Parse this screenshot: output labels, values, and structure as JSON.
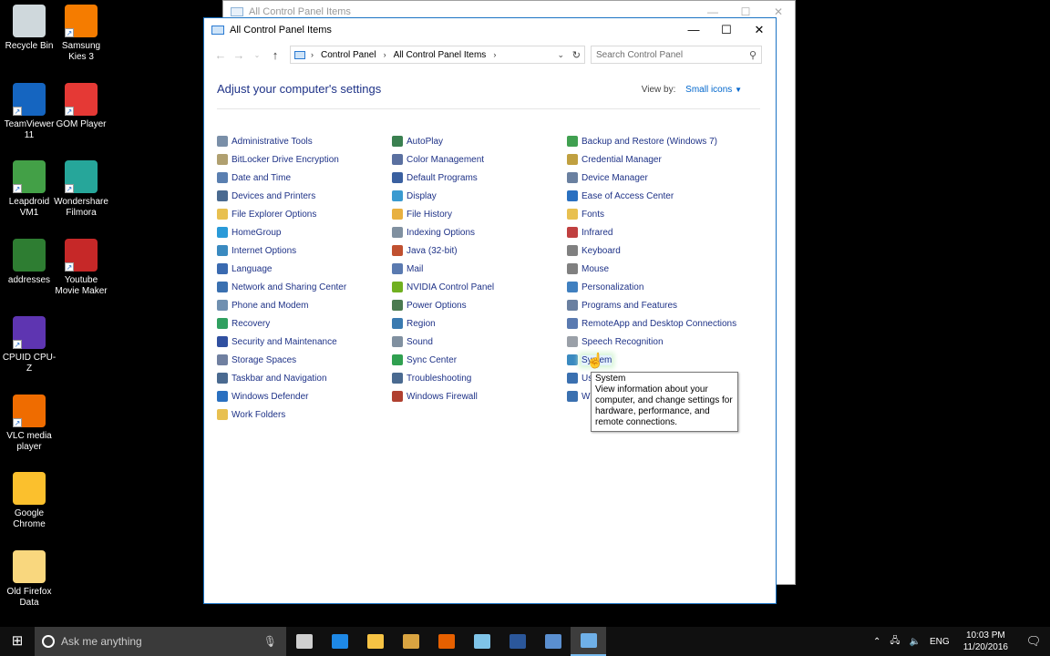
{
  "desktop": {
    "icons": [
      {
        "label": "Recycle Bin",
        "color": "#cfd8dc"
      },
      {
        "label": "Samsung Kies 3",
        "color": "#f57c00"
      },
      {
        "label": "TeamViewer 11",
        "color": "#1565c0"
      },
      {
        "label": "GOM Player",
        "color": "#e53935"
      },
      {
        "label": "Leapdroid VM1",
        "color": "#43a047"
      },
      {
        "label": "Wondershare Filmora",
        "color": "#26a69a"
      },
      {
        "label": "addresses",
        "color": "#2e7d32"
      },
      {
        "label": "Youtube Movie Maker",
        "color": "#c62828"
      },
      {
        "label": "CPUID CPU-Z",
        "color": "#5e35b1"
      },
      {
        "label": "VLC media player",
        "color": "#ef6c00"
      },
      {
        "label": "Google Chrome",
        "color": "#fbc02d"
      },
      {
        "label": "Old Firefox Data",
        "color": "#f9d77e"
      }
    ]
  },
  "bg_window": {
    "title": "All Control Panel Items"
  },
  "window": {
    "title": "All Control Panel Items",
    "breadcrumb": [
      "Control Panel",
      "All Control Panel Items"
    ],
    "search_placeholder": "Search Control Panel",
    "heading": "Adjust your computer's settings",
    "view_by_label": "View by:",
    "view_by_value": "Small icons"
  },
  "items": {
    "col1": [
      {
        "label": "Administrative Tools",
        "color": "#7a8fa8"
      },
      {
        "label": "BitLocker Drive Encryption",
        "color": "#b0a070"
      },
      {
        "label": "Date and Time",
        "color": "#5a7fb0"
      },
      {
        "label": "Devices and Printers",
        "color": "#4a6a90"
      },
      {
        "label": "File Explorer Options",
        "color": "#e8c050"
      },
      {
        "label": "HomeGroup",
        "color": "#2a9ad8"
      },
      {
        "label": "Internet Options",
        "color": "#3a8ac0"
      },
      {
        "label": "Language",
        "color": "#3a6ab0"
      },
      {
        "label": "Network and Sharing Center",
        "color": "#3a70b0"
      },
      {
        "label": "Phone and Modem",
        "color": "#7090b0"
      },
      {
        "label": "Recovery",
        "color": "#30a060"
      },
      {
        "label": "Security and Maintenance",
        "color": "#3050a0"
      },
      {
        "label": "Storage Spaces",
        "color": "#7080a0"
      },
      {
        "label": "Taskbar and Navigation",
        "color": "#4a6a90"
      },
      {
        "label": "Windows Defender",
        "color": "#2a70c0"
      },
      {
        "label": "Work Folders",
        "color": "#e8c050"
      }
    ],
    "col2": [
      {
        "label": "AutoPlay",
        "color": "#3a8050"
      },
      {
        "label": "Color Management",
        "color": "#5a70a0"
      },
      {
        "label": "Default Programs",
        "color": "#3a60a0"
      },
      {
        "label": "Display",
        "color": "#3a9ad0"
      },
      {
        "label": "File History",
        "color": "#e8b040"
      },
      {
        "label": "Indexing Options",
        "color": "#8090a0"
      },
      {
        "label": "Java (32-bit)",
        "color": "#c05030"
      },
      {
        "label": "Mail",
        "color": "#5a7ab0"
      },
      {
        "label": "NVIDIA Control Panel",
        "color": "#70b020"
      },
      {
        "label": "Power Options",
        "color": "#4a7a50"
      },
      {
        "label": "Region",
        "color": "#3a7ab0"
      },
      {
        "label": "Sound",
        "color": "#8090a0"
      },
      {
        "label": "Sync Center",
        "color": "#30a050"
      },
      {
        "label": "Troubleshooting",
        "color": "#4a6a90"
      },
      {
        "label": "Windows Firewall",
        "color": "#b04030"
      }
    ],
    "col3": [
      {
        "label": "Backup and Restore (Windows 7)",
        "color": "#40a050"
      },
      {
        "label": "Credential Manager",
        "color": "#c0a040"
      },
      {
        "label": "Device Manager",
        "color": "#6a80a0"
      },
      {
        "label": "Ease of Access Center",
        "color": "#2a70c0"
      },
      {
        "label": "Fonts",
        "color": "#e8c050"
      },
      {
        "label": "Infrared",
        "color": "#c04040"
      },
      {
        "label": "Keyboard",
        "color": "#808080"
      },
      {
        "label": "Mouse",
        "color": "#808080"
      },
      {
        "label": "Personalization",
        "color": "#4080c0"
      },
      {
        "label": "Programs and Features",
        "color": "#6a80a0"
      },
      {
        "label": "RemoteApp and Desktop Connections",
        "color": "#5a7ab0"
      },
      {
        "label": "Speech Recognition",
        "color": "#9aa0a8"
      },
      {
        "label": "System",
        "color": "#3a8ac0"
      },
      {
        "label": "Us",
        "color": "#3a70b0"
      },
      {
        "label": "Wi",
        "color": "#3a70b0"
      }
    ]
  },
  "tooltip": {
    "title": "System",
    "text": "View information about your computer, and change settings for hardware, performance, and remote connections."
  },
  "taskbar": {
    "search_text": "Ask me anything",
    "apps": [
      {
        "name": "task-view",
        "color": "#cfcfcf"
      },
      {
        "name": "edge",
        "color": "#1e88e5"
      },
      {
        "name": "file-explorer",
        "color": "#f6c344"
      },
      {
        "name": "media-app",
        "color": "#d9a441"
      },
      {
        "name": "firefox",
        "color": "#e66000"
      },
      {
        "name": "notepad-app",
        "color": "#7fc4e8"
      },
      {
        "name": "word",
        "color": "#2b579a"
      },
      {
        "name": "remote-desktop",
        "color": "#5a8fd0"
      },
      {
        "name": "control-panel",
        "color": "#6fb0e8"
      }
    ],
    "language": "ENG",
    "time": "10:03 PM",
    "date": "11/20/2016"
  }
}
